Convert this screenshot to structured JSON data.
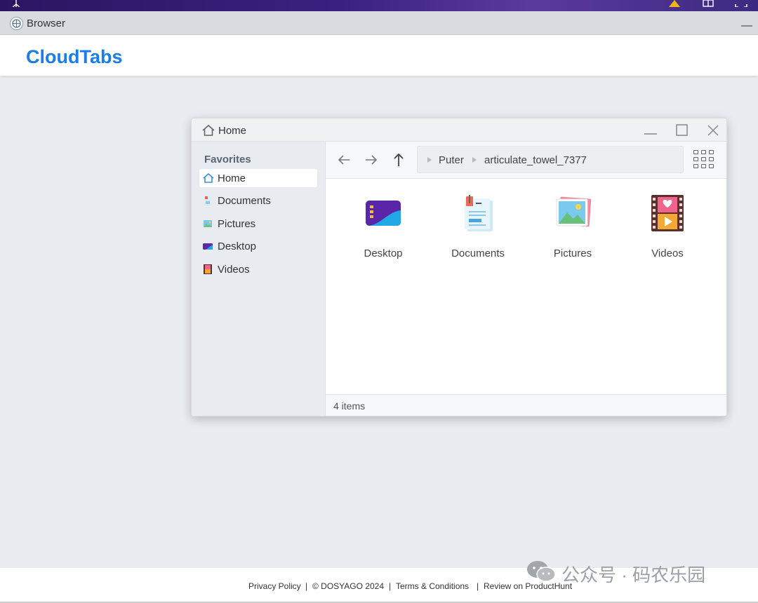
{
  "browser": {
    "title": "Browser"
  },
  "site": {
    "brand": "CloudTabs"
  },
  "window": {
    "title": "Home",
    "controls": [
      "minimize",
      "maximize",
      "close"
    ]
  },
  "sidebar": {
    "heading": "Favorites",
    "items": [
      {
        "label": "Home",
        "icon": "home-icon",
        "active": true
      },
      {
        "label": "Documents",
        "icon": "documents-icon",
        "active": false
      },
      {
        "label": "Pictures",
        "icon": "pictures-icon",
        "active": false
      },
      {
        "label": "Desktop",
        "icon": "desktop-icon",
        "active": false
      },
      {
        "label": "Videos",
        "icon": "videos-icon",
        "active": false
      }
    ]
  },
  "breadcrumb": [
    "Puter",
    "articulate_towel_7377"
  ],
  "files": [
    {
      "label": "Desktop",
      "icon": "desktop-folder-icon"
    },
    {
      "label": "Documents",
      "icon": "documents-folder-icon"
    },
    {
      "label": "Pictures",
      "icon": "pictures-folder-icon"
    },
    {
      "label": "Videos",
      "icon": "videos-folder-icon"
    }
  ],
  "status": {
    "count": "4 items"
  },
  "footer": {
    "privacy": "Privacy Policy",
    "copyright": "© DOSYAGO 2024",
    "terms": "Terms & Conditions",
    "review": "Review on ProductHunt"
  },
  "watermark": {
    "text": "公众号 · 码农乐园"
  },
  "colors": {
    "brand": "#1a7de8",
    "topbar": "#2a1660"
  }
}
